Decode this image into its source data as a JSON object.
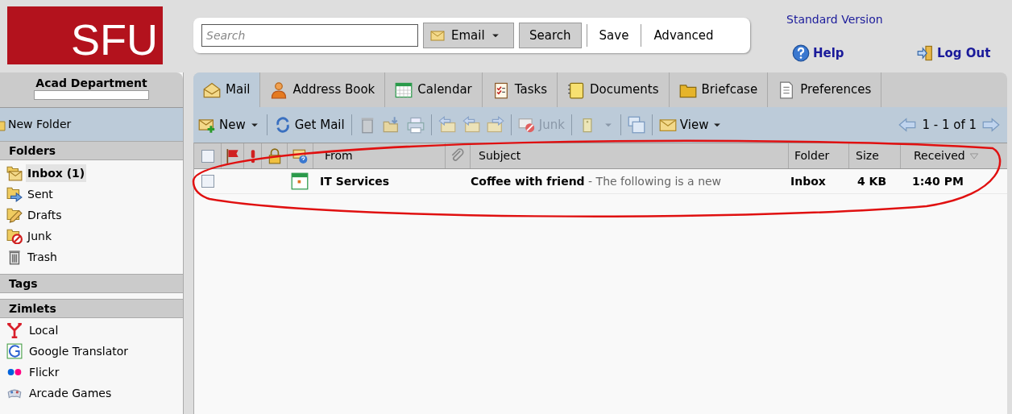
{
  "header": {
    "logo": "SFU",
    "search": {
      "placeholder": "Search"
    },
    "search_type": "Email",
    "buttons": [
      "Search",
      "Save",
      "Advanced"
    ],
    "version_link": "Standard Version",
    "help": "Help",
    "logout": "Log Out"
  },
  "sidebar": {
    "account": "Acad Department",
    "new_folder": "New Folder",
    "folders": {
      "title": "Folders",
      "items": [
        {
          "label": "Inbox (1)",
          "selected": true
        },
        {
          "label": "Sent",
          "selected": false
        },
        {
          "label": "Drafts",
          "selected": false
        },
        {
          "label": "Junk",
          "selected": false
        },
        {
          "label": "Trash",
          "selected": false
        }
      ]
    },
    "tags": {
      "title": "Tags"
    },
    "zimlets": {
      "title": "Zimlets",
      "items": [
        "Local",
        "Google Translator",
        "Flickr",
        "Arcade Games"
      ]
    }
  },
  "tabs": [
    {
      "label": "Mail",
      "selected": true
    },
    {
      "label": "Address Book",
      "selected": false
    },
    {
      "label": "Calendar",
      "selected": false
    },
    {
      "label": "Tasks",
      "selected": false
    },
    {
      "label": "Documents",
      "selected": false
    },
    {
      "label": "Briefcase",
      "selected": false
    },
    {
      "label": "Preferences",
      "selected": false
    }
  ],
  "toolbar": {
    "new": "New",
    "get_mail": "Get Mail",
    "junk": "Junk",
    "view": "View",
    "pagination": "1 - 1 of 1"
  },
  "table": {
    "select_all": {
      "checked": false
    },
    "columns": [
      "From",
      "Subject",
      "Folder",
      "Size",
      "Received"
    ],
    "rows": [
      {
        "checked": false,
        "from": "IT Services",
        "subject": "Coffee with friend",
        "fragment": "- The following is a new",
        "folder": "Inbox",
        "size": "4 KB",
        "received": "1:40 PM"
      }
    ]
  }
}
